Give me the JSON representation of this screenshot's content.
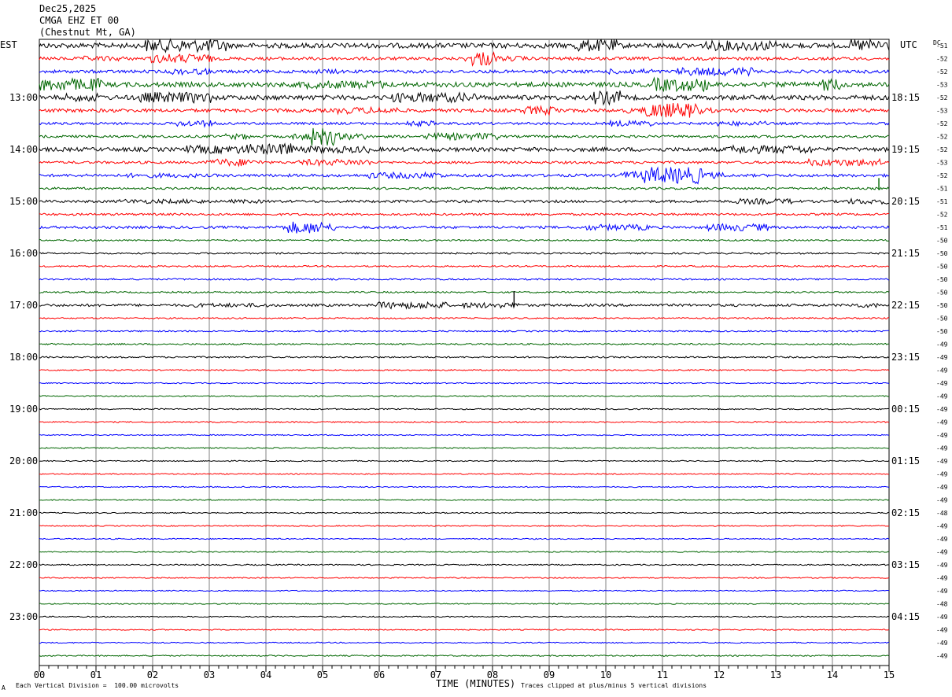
{
  "header": {
    "date": "Dec25,2025",
    "station": "CMGA EHZ ET 00",
    "location": "(Chestnut Mt, GA)"
  },
  "left_tz": "EST",
  "right_tz": "UTC",
  "dc_label": "DC",
  "footer": {
    "scale": "Each Vertical Division =  100.00 microvolts",
    "xlabel": "TIME (MINUTES)",
    "clip_note": "Traces clipped at plus/minus 5 vertical divisions",
    "corner": "A"
  },
  "colors": {
    "black": "#000000",
    "red": "#ff0000",
    "blue": "#0000ff",
    "green": "#006600",
    "grid": "#808080"
  },
  "chart_data": {
    "type": "line",
    "title": "CMGA EHZ ET 00",
    "xlabel": "TIME (MINUTES)",
    "xlim": [
      0,
      15
    ],
    "x_ticks": [
      "00",
      "01",
      "02",
      "03",
      "04",
      "05",
      "06",
      "07",
      "08",
      "09",
      "10",
      "11",
      "12",
      "13",
      "14",
      "15"
    ],
    "left_hour_labels": [
      "13:00",
      "14:00",
      "15:00",
      "16:00",
      "17:00",
      "18:00",
      "19:00",
      "20:00",
      "21:00",
      "22:00",
      "23:00"
    ],
    "right_hour_labels": [
      "18:15",
      "19:15",
      "20:15",
      "21:15",
      "22:15",
      "23:15",
      "00:15",
      "01:15",
      "02:15",
      "03:15",
      "04:15"
    ],
    "dc_offsets": [
      -51,
      -52,
      -52,
      -53,
      -52,
      -53,
      -52,
      -52,
      -52,
      -53,
      -52,
      -51,
      -51,
      -52,
      -51,
      -50,
      -50,
      -50,
      -50,
      -50,
      -50,
      -50,
      -50,
      -49,
      -49,
      -49,
      -49,
      -49,
      -49,
      -49,
      -49,
      -49,
      -49,
      -49,
      -49,
      -49,
      -48,
      -49,
      -49,
      -49,
      -49,
      -49,
      -49,
      -48,
      -49,
      -49,
      -49,
      -49
    ],
    "trace_colors": [
      "black",
      "red",
      "blue",
      "green"
    ],
    "trace_amplitude": [
      3.2,
      2.0,
      2.0,
      3.0,
      3.0,
      2.2,
      1.6,
      1.6,
      2.6,
      1.6,
      1.8,
      1.4,
      1.6,
      1.4,
      1.6,
      1.0,
      1.0,
      1.0,
      1.0,
      1.0,
      1.6,
      0.9,
      0.9,
      1.0,
      1.0,
      0.8,
      0.7,
      0.7,
      0.8,
      0.8,
      0.7,
      0.7,
      0.7,
      0.7,
      0.7,
      0.7,
      0.7,
      0.7,
      0.7,
      0.7,
      0.8,
      0.7,
      0.7,
      0.7,
      0.7,
      0.7,
      0.7,
      0.8
    ],
    "events": [
      {
        "trace": 11,
        "minute": 14.82,
        "height": 2.2
      },
      {
        "trace": 20,
        "minute": 8.38,
        "height": 3.0
      }
    ]
  }
}
